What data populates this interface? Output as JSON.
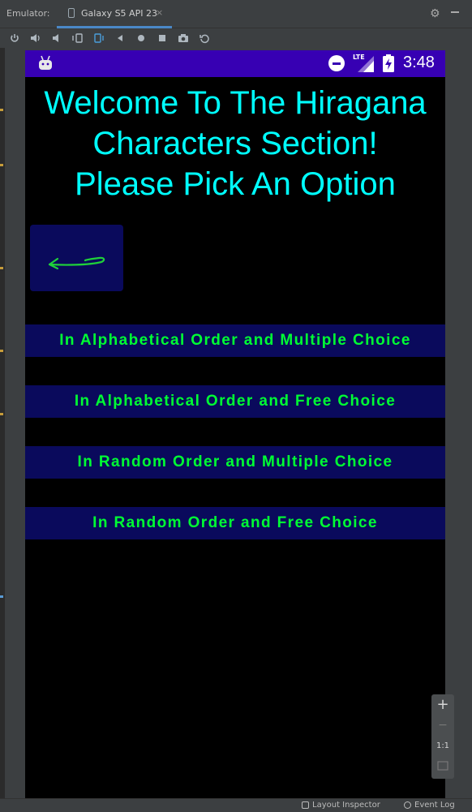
{
  "ide": {
    "label": "Emulator:",
    "tab_title": "Galaxy S5 API 23",
    "tab_close": "×",
    "toolbar_icons": [
      "power-icon",
      "volume-up-icon",
      "volume-down-icon",
      "rotate-left-icon",
      "rotate-right-icon",
      "back-icon",
      "home-icon",
      "overview-icon",
      "camera-icon",
      "replay-icon"
    ],
    "zoom": {
      "plus": "+",
      "minus": "−",
      "ratio": "1:1"
    },
    "bottom": {
      "layout_inspector": "Layout Inspector",
      "event_log": "Event Log"
    }
  },
  "status_bar": {
    "network": "LTE",
    "time": "3:48",
    "color": "#3700b3"
  },
  "screen": {
    "welcome_lines": [
      "Welcome To The Hiragana",
      "Characters Section!",
      "Please Pick An Option"
    ],
    "title_color": "#00ffff",
    "back_icon": "return-arrow-icon",
    "option_color": "#00ff33",
    "option_bg": "#0a0a5c",
    "options": [
      "In Alphabetical Order and Multiple Choice",
      "In Alphabetical Order and Free Choice",
      "In Random Order and Multiple Choice",
      "In Random Order and Free Choice"
    ]
  }
}
